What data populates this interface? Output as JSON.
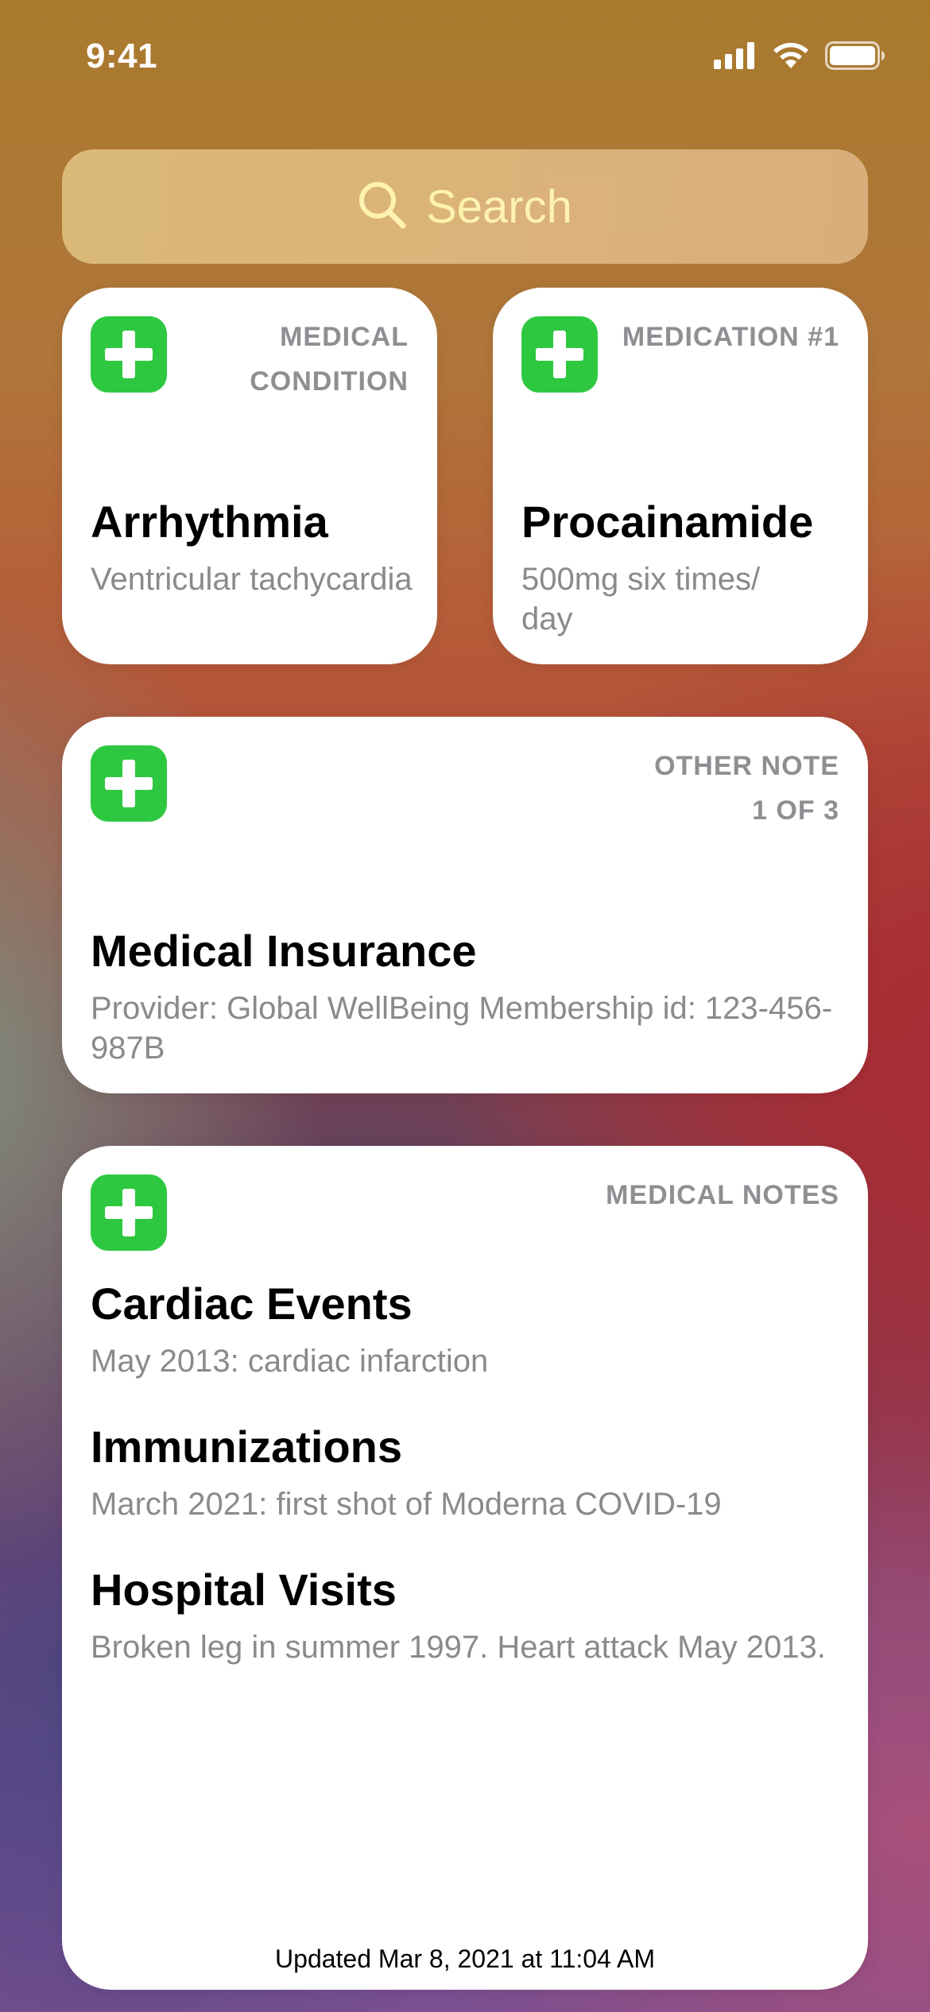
{
  "status_bar": {
    "time": "9:41",
    "signal_icon": "cellular-signal-icon",
    "wifi_icon": "wifi-icon",
    "battery_icon": "battery-icon"
  },
  "search": {
    "icon": "search-icon",
    "label": "Search"
  },
  "widgets": {
    "condition": {
      "icon": "medical-id-icon",
      "tag": "MEDICAL CONDITION",
      "title": "Arrhythmia",
      "subtitle": "Ventricular tachycardia"
    },
    "medication": {
      "icon": "medical-id-icon",
      "tag": "MEDICATION #1",
      "title": "Procainamide",
      "subtitle": "500mg six times/ day"
    },
    "insurance": {
      "icon": "medical-id-icon",
      "tag_line1": "OTHER NOTE",
      "tag_line2": "1 OF 3",
      "title": "Medical Insurance",
      "subtitle": "Provider: Global WellBeing Membership id: 123-456-987B"
    },
    "notes": {
      "icon": "medical-id-icon",
      "tag": "MEDICAL NOTES",
      "sections": [
        {
          "title": "Cardiac Events",
          "text": "May 2013: cardiac infarction"
        },
        {
          "title": "Immunizations",
          "text": "March 2021: first shot of Moderna COVID-19"
        },
        {
          "title": "Hospital Visits",
          "text": "Broken leg in summer 1997. Heart attack May 2013."
        }
      ],
      "updated": "Updated Mar 8, 2021 at 11:04 AM"
    }
  },
  "colors": {
    "icon_green": "#2ec840",
    "tag_gray": "#8e8e93",
    "search_text": "#fff2b0"
  }
}
